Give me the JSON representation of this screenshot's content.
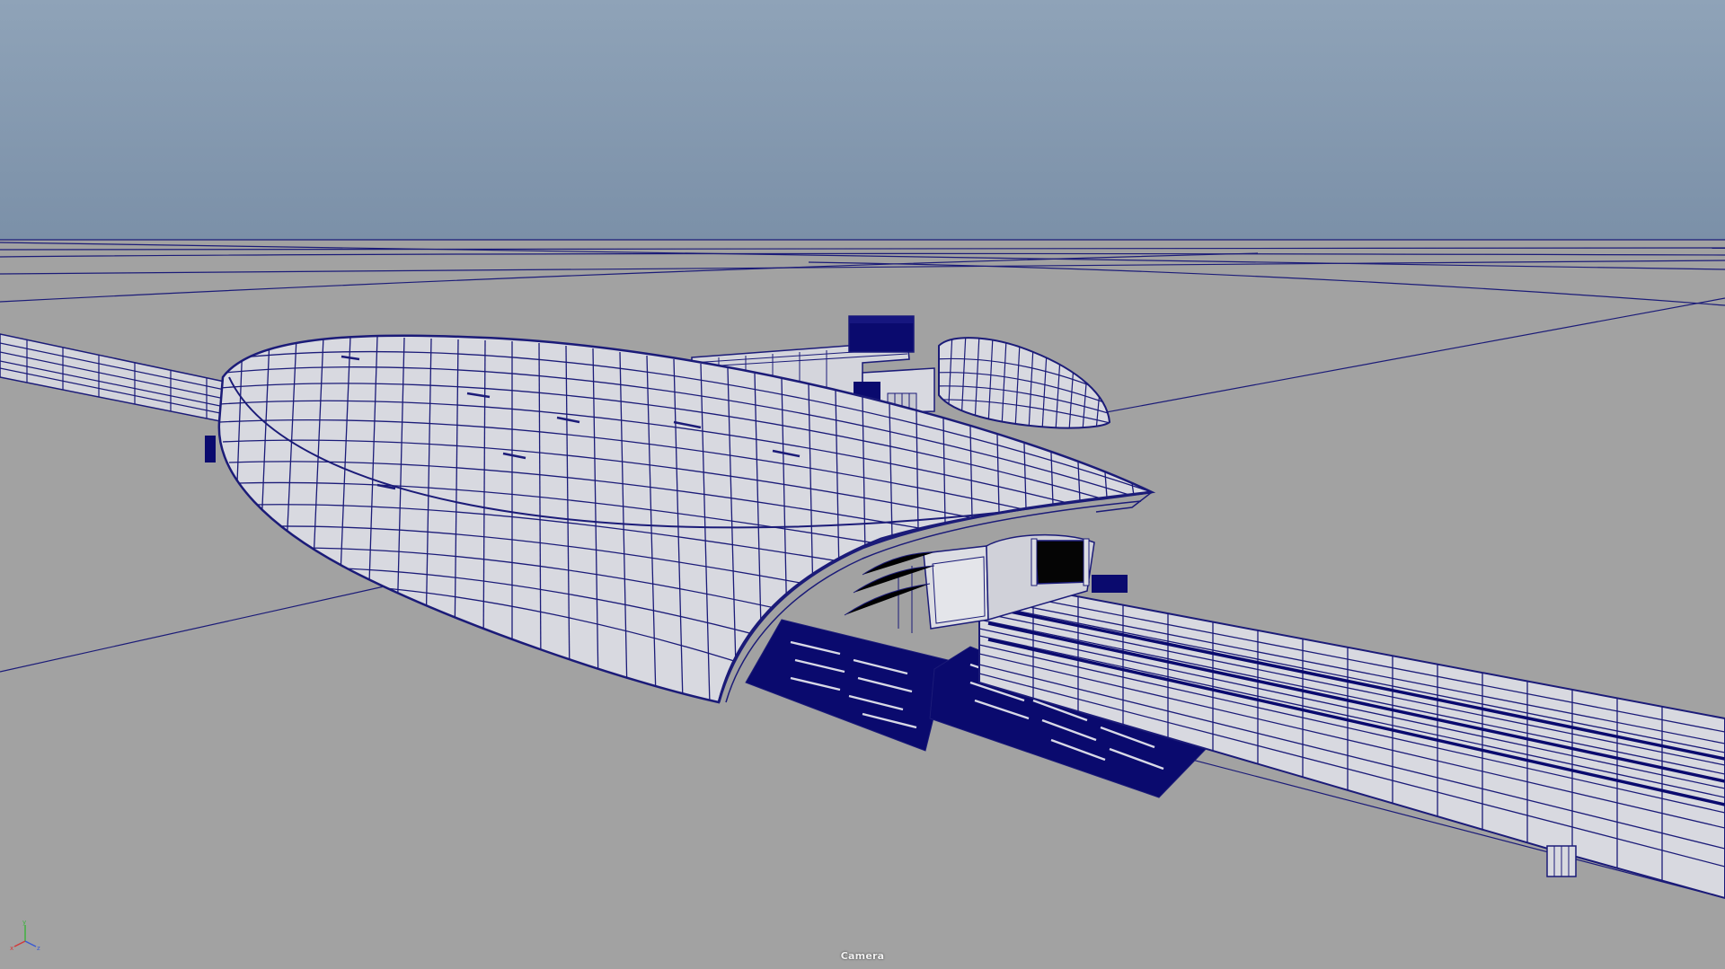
{
  "viewport": {
    "camera_label": "Camera",
    "axis_labels": {
      "x": "x",
      "y": "y",
      "z": "z"
    }
  },
  "colors": {
    "sky_top": "#8ea1b6",
    "sky_bottom": "#7e93ab",
    "ground": "#a2a2a2",
    "wire": "#1b1b78",
    "surface": "#dcdde3",
    "surface_shade": "#c8c9d2",
    "dark_panel": "#0a0a6e",
    "axis_x": "#d23a3a",
    "axis_y": "#3fb23f",
    "axis_z": "#3a5ad2"
  },
  "icons": {
    "gizmo": "axis-gizmo-icon"
  }
}
